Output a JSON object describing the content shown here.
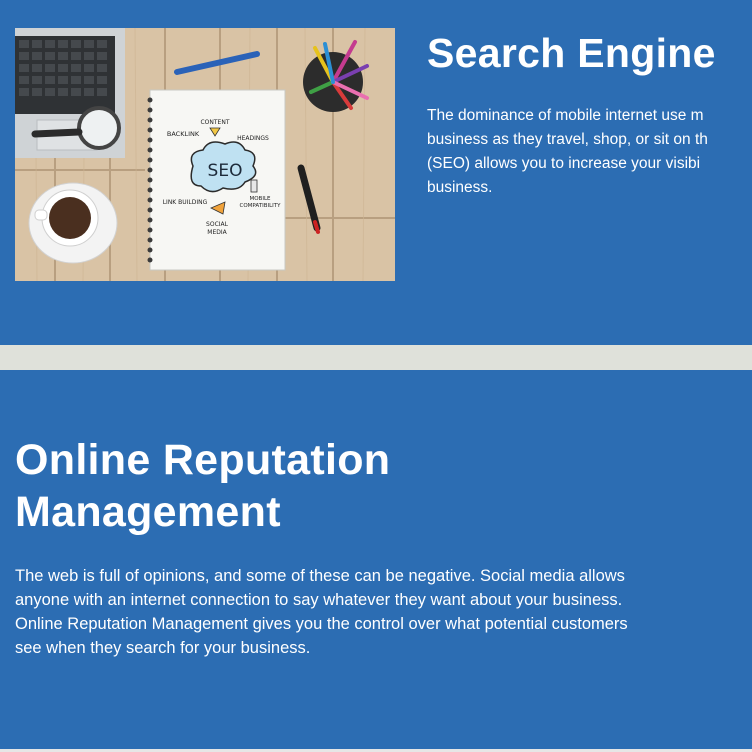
{
  "seo": {
    "title": "Search Engine",
    "image_text": {
      "center": "SEO",
      "content": "CONTENT",
      "backlink": "BACKLINK",
      "headings": "HEADINGS",
      "link_building": "LINK BUILDING",
      "mobile": "MOBILE",
      "compatibility": "COMPATIBILITY",
      "social": "SOCIAL",
      "media": "MEDIA"
    },
    "lines": [
      "The dominance of mobile internet use m",
      "business as they travel, shop, or sit on th",
      "(SEO) allows you to increase your visibi",
      "business."
    ]
  },
  "orm": {
    "title_lines": [
      "Online Reputation",
      "Management"
    ],
    "lines": [
      "The web is full of opinions, and some of these can be negative. Social media allows",
      "anyone with an internet connection to say whatever they want about your business.",
      "Online Reputation Management gives you the control over what potential customers",
      "see when they search for your business."
    ]
  },
  "colors": {
    "section_bg": "#2c6db3",
    "divider": "#dfe1da",
    "text": "#ffffff"
  }
}
